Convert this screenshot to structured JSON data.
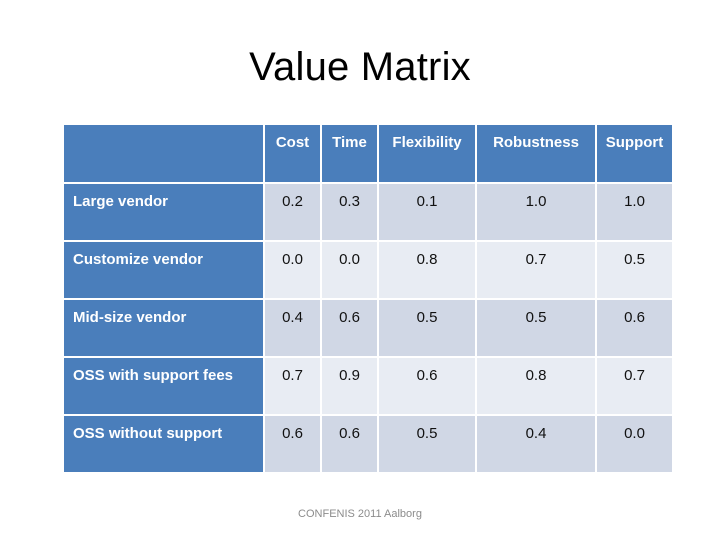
{
  "slide": {
    "title": "Value Matrix",
    "footer": "CONFENIS 2011 Aalborg"
  },
  "colors": {
    "header_blue": "#4A7EBB",
    "row_band_dark": "#D0D7E5",
    "row_band_light": "#E8ECF3",
    "header_text": "#FFFFFF",
    "body_text": "#111111",
    "footer_text": "#8C8C8C",
    "background": "#FFFFFF"
  },
  "table": {
    "corner_label": "",
    "columns": [
      "Cost",
      "Time",
      "Flexibility",
      "Robustness",
      "Support"
    ],
    "rows": [
      {
        "label": "Large vendor",
        "values": [
          "0.2",
          "0.3",
          "0.1",
          "1.0",
          "1.0"
        ]
      },
      {
        "label": "Customize vendor",
        "values": [
          "0.0",
          "0.0",
          "0.8",
          "0.7",
          "0.5"
        ]
      },
      {
        "label": "Mid-size vendor",
        "values": [
          "0.4",
          "0.6",
          "0.5",
          "0.5",
          "0.6"
        ]
      },
      {
        "label": "OSS with support fees",
        "values": [
          "0.7",
          "0.9",
          "0.6",
          "0.8",
          "0.7"
        ]
      },
      {
        "label": "OSS without support",
        "values": [
          "0.6",
          "0.6",
          "0.5",
          "0.4",
          "0.0"
        ]
      }
    ]
  },
  "chart_data": {
    "type": "table",
    "title": "Value Matrix",
    "categories": [
      "Cost",
      "Time",
      "Flexibility",
      "Robustness",
      "Support"
    ],
    "series": [
      {
        "name": "Large vendor",
        "values": [
          0.2,
          0.3,
          0.1,
          1.0,
          1.0
        ]
      },
      {
        "name": "Customize vendor",
        "values": [
          0.0,
          0.0,
          0.8,
          0.7,
          0.5
        ]
      },
      {
        "name": "Mid-size vendor",
        "values": [
          0.4,
          0.6,
          0.5,
          0.5,
          0.6
        ]
      },
      {
        "name": "OSS with support fees",
        "values": [
          0.7,
          0.9,
          0.6,
          0.8,
          0.7
        ]
      },
      {
        "name": "OSS without support",
        "values": [
          0.6,
          0.6,
          0.5,
          0.4,
          0.0
        ]
      }
    ],
    "xlabel": "",
    "ylabel": "",
    "value_range": [
      0.0,
      1.0
    ],
    "grid": false,
    "legend": "none",
    "annotations": [
      "CONFENIS 2011 Aalborg"
    ]
  }
}
